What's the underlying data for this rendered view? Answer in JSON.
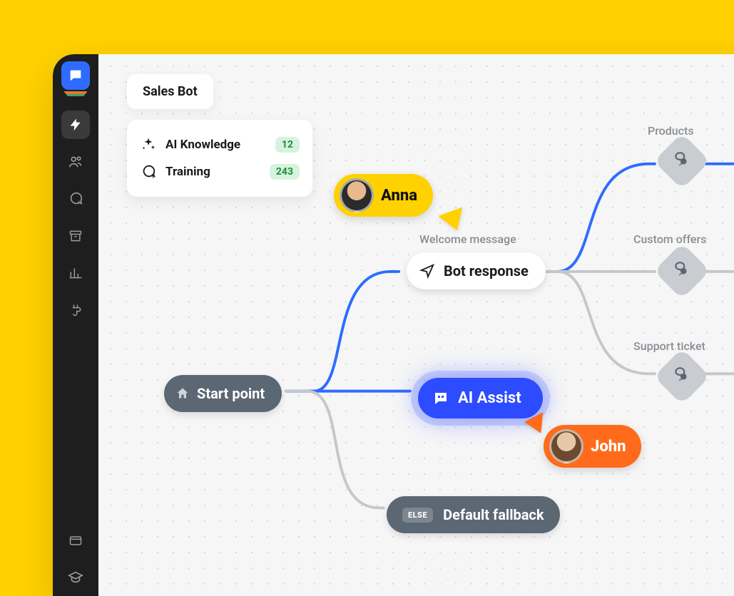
{
  "title": "Sales Bot",
  "panel": {
    "ai_knowledge": {
      "label": "AI Knowledge",
      "count": "12"
    },
    "training": {
      "label": "Training",
      "count": "243"
    }
  },
  "nodes": {
    "start": "Start point",
    "welcome_label": "Welcome message",
    "response": "Bot response",
    "ai_assist": "AI Assist",
    "else": "ELSE",
    "fallback": "Default fallback"
  },
  "branches": {
    "products": "Products",
    "custom_offers": "Custom offers",
    "support_ticket": "Support ticket"
  },
  "users": {
    "anna": "Anna",
    "john": "John"
  }
}
